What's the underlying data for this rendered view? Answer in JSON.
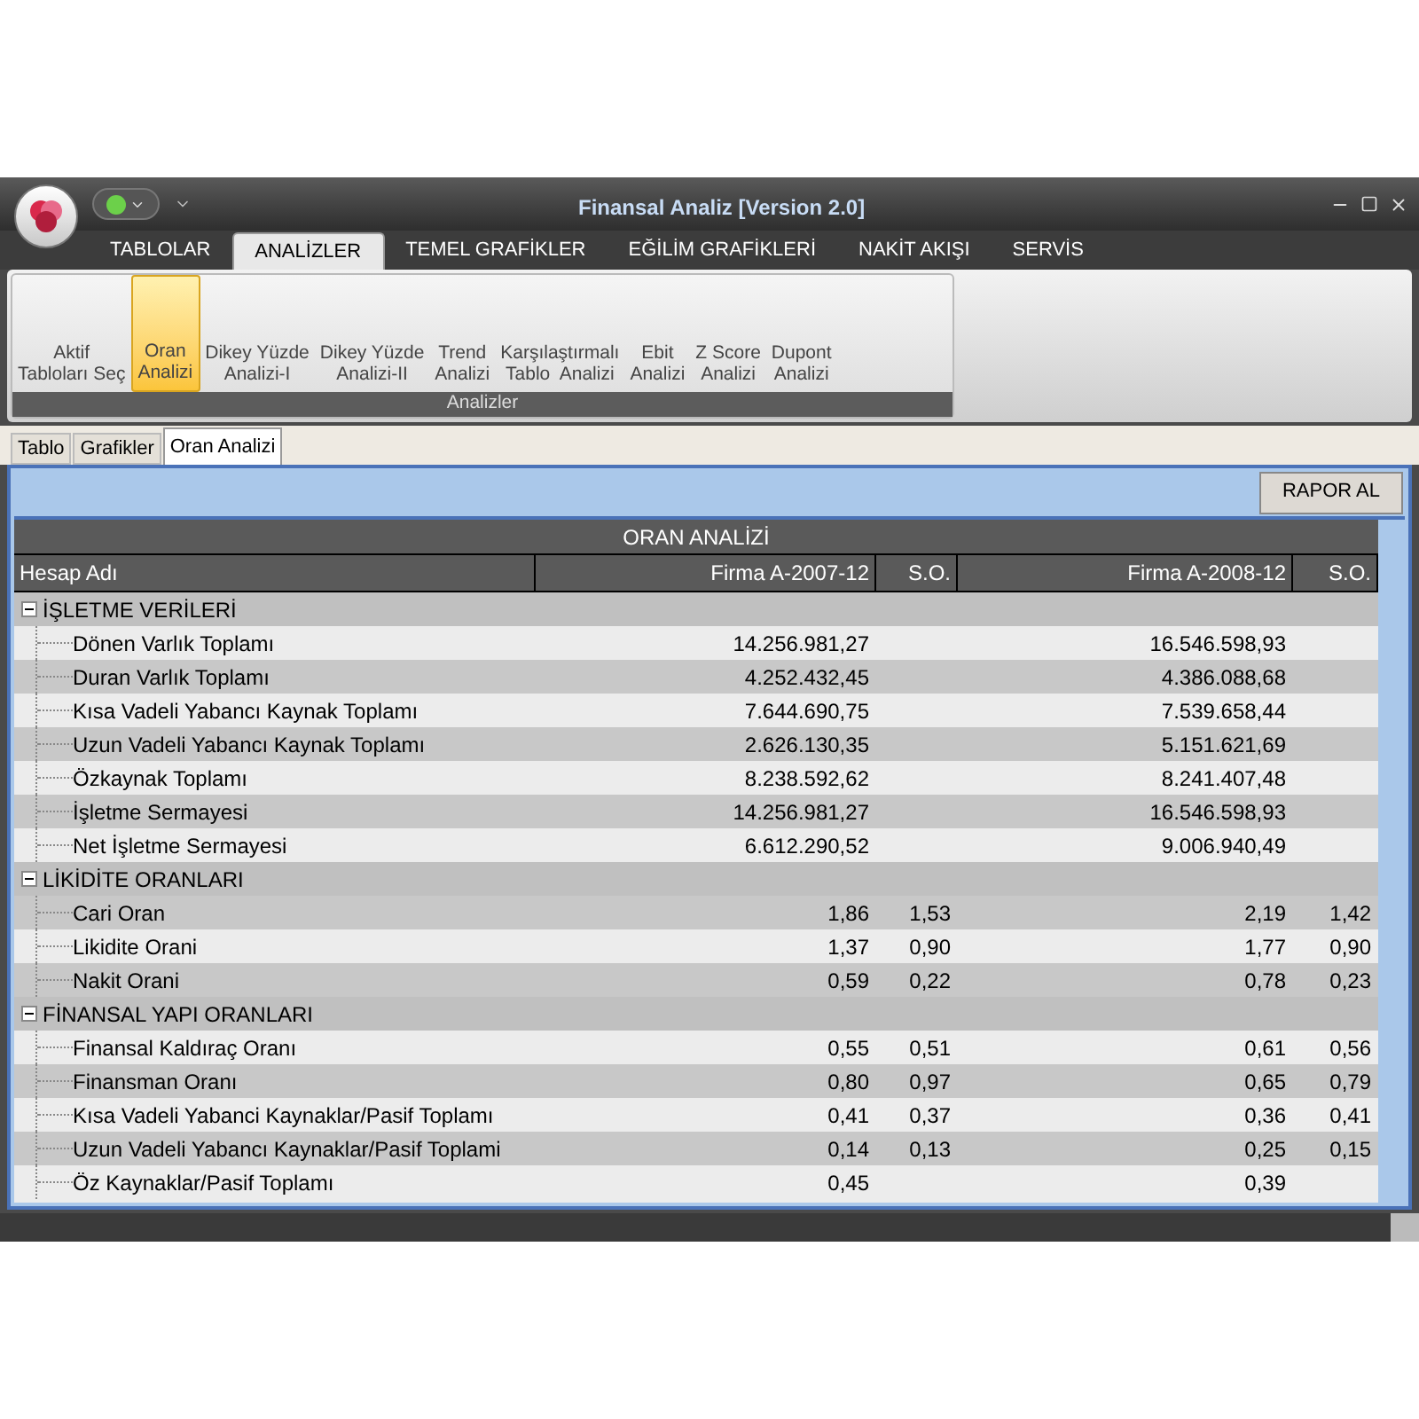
{
  "window": {
    "title": "Finansal Analiz [Version 2.0]"
  },
  "ribbon_tabs": [
    {
      "label": "TABLOLAR",
      "selected": false
    },
    {
      "label": "ANALİZLER",
      "selected": true
    },
    {
      "label": "TEMEL GRAFİKLER",
      "selected": false
    },
    {
      "label": "EĞİLİM GRAFİKLERİ",
      "selected": false
    },
    {
      "label": "NAKİT AKIŞI",
      "selected": false
    },
    {
      "label": "SERVİS",
      "selected": false
    }
  ],
  "ribbon_group": {
    "label": "Analizler",
    "buttons": [
      {
        "lines": [
          "Aktif",
          "Tabloları Seç"
        ],
        "selected": false
      },
      {
        "lines": [
          "Oran",
          "Analizi"
        ],
        "selected": true
      },
      {
        "lines": [
          "Dikey Yüzde",
          "Analizi-I"
        ],
        "selected": false
      },
      {
        "lines": [
          "Dikey Yüzde",
          "Analizi-II"
        ],
        "selected": false
      },
      {
        "lines": [
          "Trend",
          "Analizi"
        ],
        "selected": false
      },
      {
        "lines": [
          "Karşılaştırmalı",
          "Tablo  Analizi"
        ],
        "selected": false
      },
      {
        "lines": [
          "Ebit",
          "Analizi"
        ],
        "selected": false
      },
      {
        "lines": [
          "Z Score",
          "Analizi"
        ],
        "selected": false
      },
      {
        "lines": [
          "Dupont",
          "Analizi"
        ],
        "selected": false
      }
    ]
  },
  "document_tabs": [
    {
      "label": "Tablo",
      "selected": false
    },
    {
      "label": "Grafikler",
      "selected": false
    },
    {
      "label": "Oran Analizi",
      "selected": true
    }
  ],
  "report_button": "RAPOR AL",
  "table": {
    "title": "ORAN ANALİZİ",
    "columns": [
      "Hesap Adı",
      "Firma A-2007-12",
      "S.O.",
      "Firma A-2008-12",
      "S.O."
    ],
    "groups": [
      {
        "label": "İŞLETME VERİLERİ",
        "expanded": true,
        "children": [
          {
            "name": "Dönen Varlık Toplamı",
            "firma_2007": "14.256.981,27",
            "firma_2008": "16.546.598,93"
          },
          {
            "name": "Duran Varlık Toplamı",
            "firma_2007": "4.252.432,45",
            "firma_2008": "4.386.088,68"
          },
          {
            "name": "Kısa Vadeli Yabancı Kaynak Toplamı",
            "firma_2007": "7.644.690,75",
            "firma_2008": "7.539.658,44"
          },
          {
            "name": "Uzun Vadeli Yabancı Kaynak Toplamı",
            "firma_2007": "2.626.130,35",
            "firma_2008": "5.151.621,69"
          },
          {
            "name": "Özkaynak Toplamı",
            "firma_2007": "8.238.592,62",
            "firma_2008": "8.241.407,48"
          },
          {
            "name": "İşletme Sermayesi",
            "firma_2007": "14.256.981,27",
            "firma_2008": "16.546.598,93"
          },
          {
            "name": "Net İşletme Sermayesi",
            "firma_2007": "6.612.290,52",
            "firma_2008": "9.006.940,49"
          }
        ]
      },
      {
        "label": "LİKİDİTE ORANLARI",
        "expanded": true,
        "children": [
          {
            "name": "Cari Oran",
            "firma_2007": "1,86",
            "so_2007": "1,53",
            "firma_2008": "2,19",
            "so_2008": "1,42"
          },
          {
            "name": "Likidite Orani",
            "firma_2007": "1,37",
            "so_2007": "0,90",
            "firma_2008": "1,77",
            "so_2008": "0,90"
          },
          {
            "name": "Nakit Orani",
            "firma_2007": "0,59",
            "so_2007": "0,22",
            "firma_2008": "0,78",
            "so_2008": "0,23"
          }
        ]
      },
      {
        "label": "FİNANSAL YAPI ORANLARI",
        "expanded": true,
        "children": [
          {
            "name": "Finansal Kaldıraç Oranı",
            "firma_2007": "0,55",
            "so_2007": "0,51",
            "firma_2008": "0,61",
            "so_2008": "0,56"
          },
          {
            "name": "Finansman Oranı",
            "firma_2007": "0,80",
            "so_2007": "0,97",
            "firma_2008": "0,65",
            "so_2008": "0,79"
          },
          {
            "name": "Kısa Vadeli Yabanci Kaynaklar/Pasif Toplamı",
            "firma_2007": "0,41",
            "so_2007": "0,37",
            "firma_2008": "0,36",
            "so_2008": "0,41"
          },
          {
            "name": "Uzun Vadeli Yabancı Kaynaklar/Pasif Toplami",
            "firma_2007": "0,14",
            "so_2007": "0,13",
            "firma_2008": "0,25",
            "so_2008": "0,15"
          },
          {
            "name": "Öz Kaynaklar/Pasif Toplamı",
            "firma_2007": "0,45",
            "firma_2008": "0,39"
          }
        ]
      }
    ]
  }
}
